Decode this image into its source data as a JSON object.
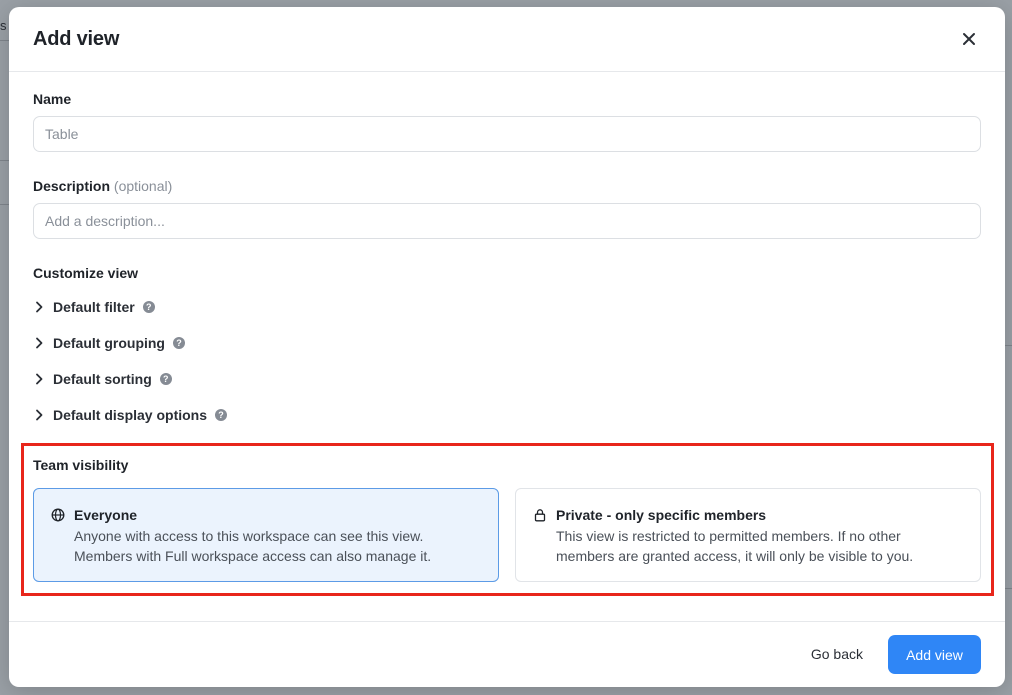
{
  "backdrop": {
    "edge_text": "s"
  },
  "modal": {
    "title": "Add view",
    "close_icon": "close-icon"
  },
  "name_field": {
    "label": "Name",
    "value": "",
    "placeholder": "Table"
  },
  "description_field": {
    "label": "Description",
    "optional_hint": "(optional)",
    "value": "",
    "placeholder": "Add a description..."
  },
  "customize": {
    "label": "Customize view",
    "items": [
      {
        "label": "Default filter",
        "icon": "chevron-right-icon",
        "help_icon": "help-icon",
        "help_glyph": "?"
      },
      {
        "label": "Default grouping",
        "icon": "chevron-right-icon",
        "help_icon": "help-icon",
        "help_glyph": "?"
      },
      {
        "label": "Default sorting",
        "icon": "chevron-right-icon",
        "help_icon": "help-icon",
        "help_glyph": "?"
      },
      {
        "label": "Default display options",
        "icon": "chevron-right-icon",
        "help_icon": "help-icon",
        "help_glyph": "?"
      }
    ]
  },
  "team_visibility": {
    "label": "Team visibility",
    "highlight_color": "#e8261b",
    "options": [
      {
        "title": "Everyone",
        "icon": "globe-icon",
        "description_line1": "Anyone with access to this workspace can see this view.",
        "description_line2": "Members with Full workspace access can also manage it.",
        "selected": true
      },
      {
        "title": "Private - only specific members",
        "icon": "lock-icon",
        "description_line1": "This view is restricted to permitted members. If no other",
        "description_line2": "members are granted access, it will only be visible to you.",
        "selected": false
      }
    ]
  },
  "footer": {
    "back_label": "Go back",
    "submit_label": "Add view",
    "accent_color": "#2f86f6"
  }
}
